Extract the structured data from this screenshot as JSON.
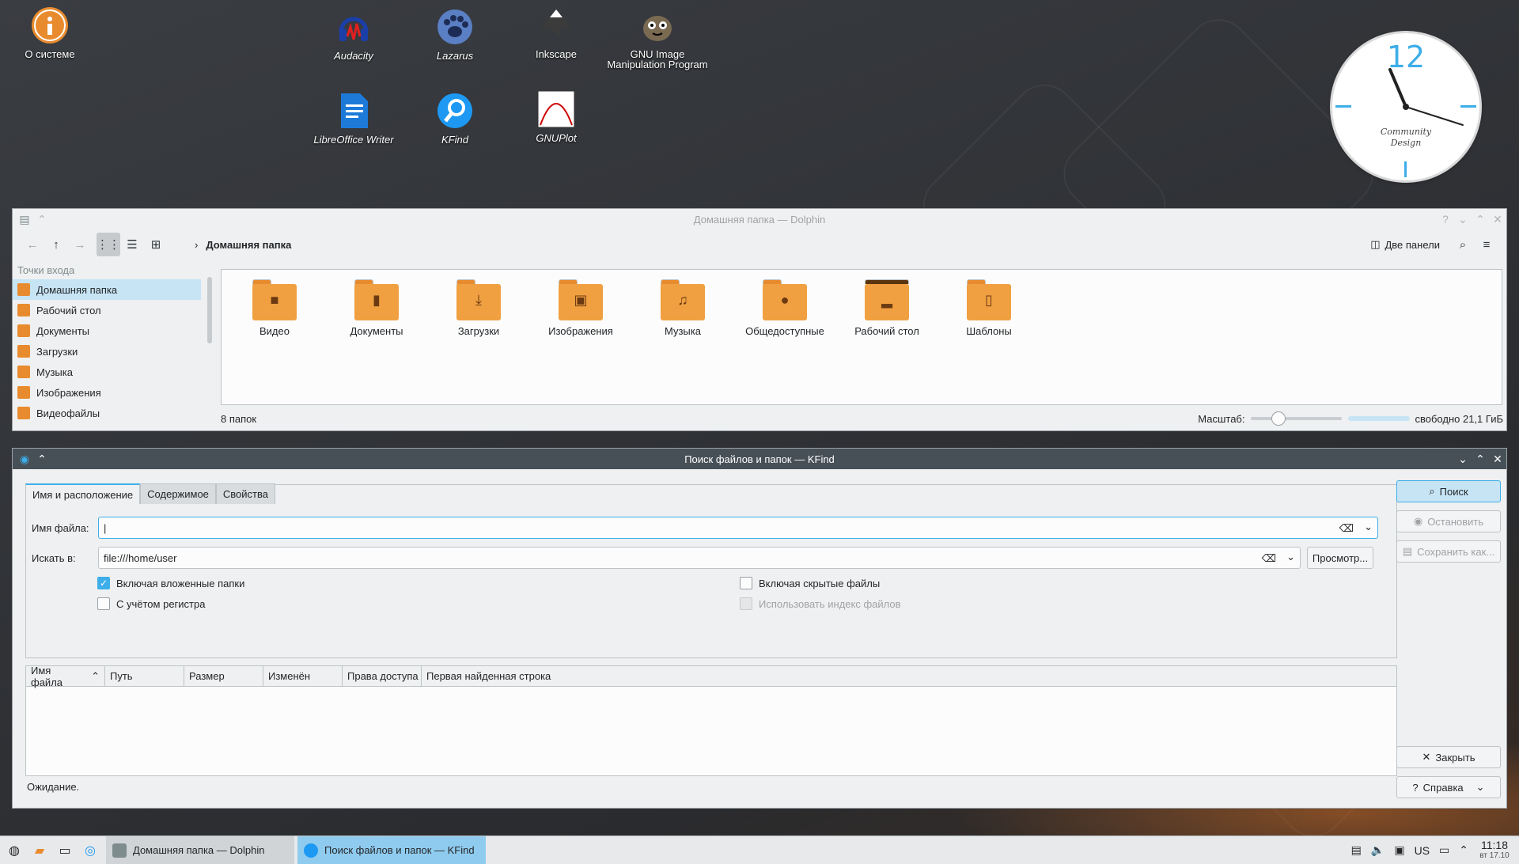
{
  "desktop": {
    "icons": [
      {
        "label": "О системе",
        "italic": false
      },
      {
        "label": "Audacity",
        "italic": true
      },
      {
        "label": "Lazarus",
        "italic": true
      },
      {
        "label": "Inkscape",
        "italic": false
      },
      {
        "label": "GNU Image Manipulation Program",
        "italic": false
      },
      {
        "label": "LibreOffice Writer",
        "italic": true
      },
      {
        "label": "KFind",
        "italic": true
      },
      {
        "label": "GNUPlot",
        "italic": true
      }
    ],
    "clock": {
      "number": "12",
      "brand_line1": "Community",
      "brand_line2": "Design"
    }
  },
  "dolphin": {
    "title": "Домашняя папка — Dolphin",
    "breadcrumb": "Домашняя папка",
    "split_label": "Две панели",
    "places_header": "Точки входа",
    "places": [
      {
        "label": "Домашняя папка",
        "selected": true
      },
      {
        "label": "Рабочий стол",
        "selected": false
      },
      {
        "label": "Документы",
        "selected": false
      },
      {
        "label": "Загрузки",
        "selected": false
      },
      {
        "label": "Музыка",
        "selected": false
      },
      {
        "label": "Изображения",
        "selected": false
      },
      {
        "label": "Видеофайлы",
        "selected": false
      }
    ],
    "folders": [
      {
        "label": "Видео",
        "emblem": "camera"
      },
      {
        "label": "Документы",
        "emblem": "document"
      },
      {
        "label": "Загрузки",
        "emblem": "download"
      },
      {
        "label": "Изображения",
        "emblem": "image"
      },
      {
        "label": "Музыка",
        "emblem": "music"
      },
      {
        "label": "Общедоступные",
        "emblem": "user"
      },
      {
        "label": "Рабочий стол",
        "emblem": "desktop"
      },
      {
        "label": "Шаблоны",
        "emblem": "template"
      }
    ],
    "status": {
      "count": "8 папок",
      "zoom_label": "Масштаб:",
      "free": "свободно 21,1 ГиБ"
    }
  },
  "kfind": {
    "title": "Поиск файлов и папок — KFind",
    "tabs": [
      "Имя и расположение",
      "Содержимое",
      "Свойства"
    ],
    "filename_label": "Имя файла:",
    "filename_value": "|",
    "lookin_label": "Искать в:",
    "lookin_value": "file:///home/user",
    "browse_button": "Просмотр...",
    "checks": {
      "subfolders": "Включая вложенные папки",
      "case": "С учётом регистра",
      "hidden": "Включая скрытые файлы",
      "index": "Использовать индекс файлов"
    },
    "buttons": {
      "search": "Поиск",
      "stop": "Остановить",
      "save": "Сохранить как...",
      "close": "Закрыть",
      "help": "Справка"
    },
    "columns": [
      "Имя файла",
      "Путь",
      "Размер",
      "Изменён",
      "Права доступа",
      "Первая найденная строка"
    ],
    "status": "Ожидание."
  },
  "taskbar": {
    "tasks": [
      "Домашняя папка — Dolphin",
      "Поиск файлов и папок — KFind"
    ],
    "layout": "US",
    "time": "11:18",
    "date": "вт 17.10"
  },
  "colors": {
    "accent": "#3daee9",
    "folder": "#f0a040",
    "kfind_titlebar": "#475057"
  }
}
